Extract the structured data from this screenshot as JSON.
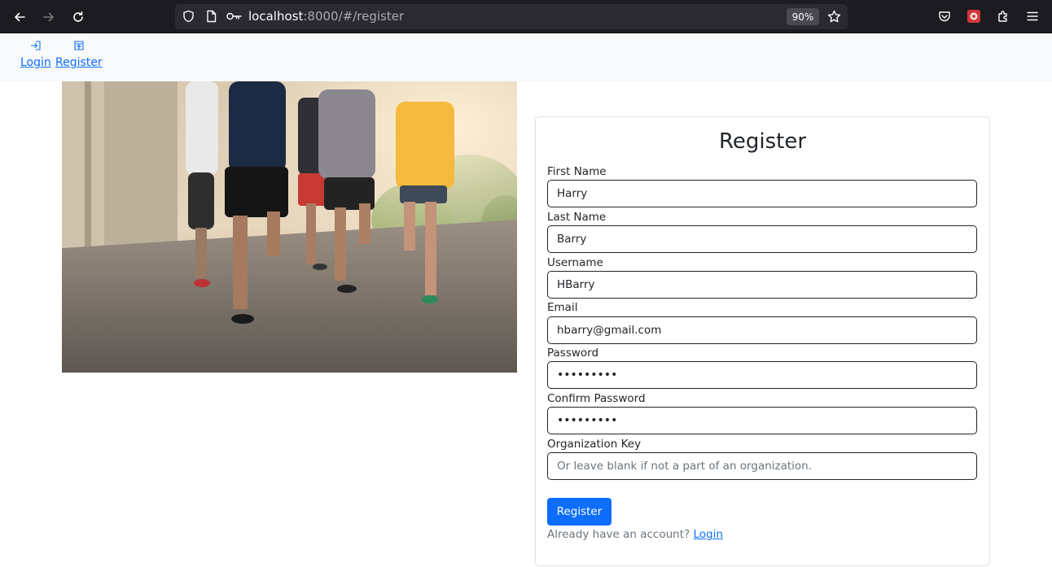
{
  "browser": {
    "url_host": "localhost",
    "url_path": ":8000/#/register",
    "zoom": "90%"
  },
  "navbar": {
    "links": [
      {
        "label": "Login",
        "icon": "login-icon"
      },
      {
        "label": "Register",
        "icon": "register-icon"
      }
    ]
  },
  "form": {
    "title": "Register",
    "fields": {
      "first_name": {
        "label": "First Name",
        "value": "Harry"
      },
      "last_name": {
        "label": "Last Name",
        "value": "Barry"
      },
      "username": {
        "label": "Username",
        "value": "HBarry"
      },
      "email": {
        "label": "Email",
        "value": "hbarry@gmail.com"
      },
      "password": {
        "label": "Password",
        "value": "•••••••••"
      },
      "confirm_password": {
        "label": "Confirm Password",
        "value": "•••••••••"
      },
      "org_key": {
        "label": "Organization Key",
        "value": "",
        "placeholder": "Or leave blank if not a part of an organization."
      }
    },
    "submit_label": "Register",
    "footer_text": "Already have an account? ",
    "footer_link": "Login"
  },
  "colors": {
    "primary": "#0d6efd",
    "browser_bg": "#1c1b22",
    "navbar_bg": "#f8f9fa"
  }
}
